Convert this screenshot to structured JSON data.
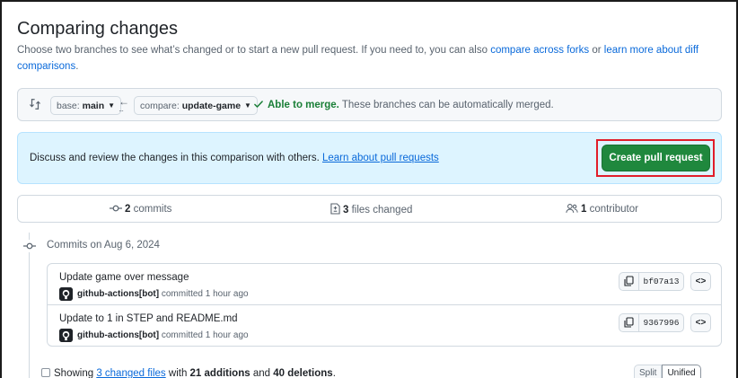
{
  "page": {
    "title": "Comparing changes",
    "description_prefix": "Choose two branches to see what’s changed or to start a new pull request. If you need to, you can also ",
    "link_compare_forks": "compare across forks",
    "description_or": " or ",
    "link_learn_diff": "learn more about diff comparisons",
    "description_suffix": "."
  },
  "range": {
    "base_prefix": "base:",
    "base_branch": "main",
    "compare_prefix": "compare:",
    "compare_branch": "update-game",
    "merge_status": "Able to merge.",
    "merge_detail": " These branches can be automatically merged."
  },
  "discuss": {
    "text": "Discuss and review the changes in this comparison with others. ",
    "link": "Learn about pull requests",
    "button": "Create pull request"
  },
  "summary": {
    "commits_count": "2",
    "commits_label": " commits",
    "files_count": "3",
    "files_label": " files changed",
    "contributors_count": "1",
    "contributors_label": " contributor"
  },
  "commits": {
    "date_header": "Commits on Aug 6, 2024",
    "items": [
      {
        "message": "Update game over message",
        "author": "github-actions[bot]",
        "meta": " committed 1 hour ago",
        "sha": "bf07a13"
      },
      {
        "message": "Update to 1 in STEP and README.md",
        "author": "github-actions[bot]",
        "meta": " committed 1 hour ago",
        "sha": "9367996"
      }
    ]
  },
  "diff": {
    "prefix": "Showing ",
    "changed_files_link": "3 changed files",
    "with": " with ",
    "additions": "21 additions",
    "and": " and ",
    "deletions": "40 deletions",
    "suffix": ".",
    "split_label": "Split",
    "unified_label": "Unified"
  },
  "colors": {
    "primary_button": "#1f883d",
    "highlight_box": "#e11d2a",
    "merge_ok": "#1a7f37",
    "link": "#0969da",
    "banner_bg": "#ddf4ff"
  },
  "icons": {
    "swap": "git-compare-icon",
    "check": "check-icon",
    "commit": "git-commit-icon",
    "files": "file-diff-icon",
    "contributors": "people-icon",
    "copy": "copy-icon",
    "browse": "code-icon"
  }
}
